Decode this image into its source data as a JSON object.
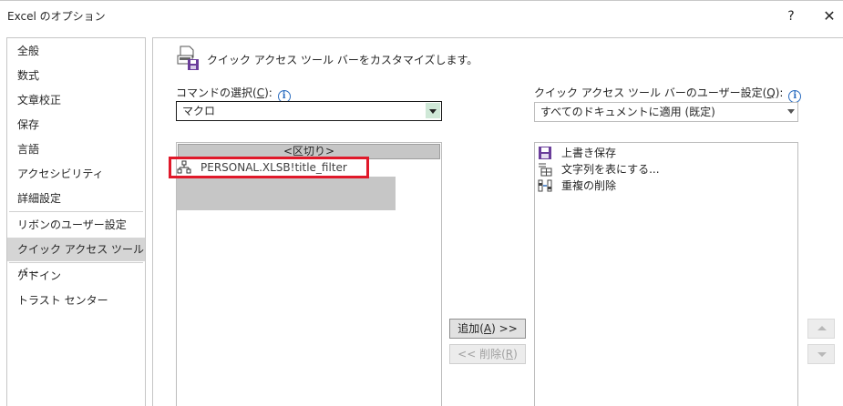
{
  "window": {
    "title": "Excel のオプション",
    "help": "?",
    "close": "✕"
  },
  "sidebar": {
    "items": [
      {
        "label": "全般"
      },
      {
        "label": "数式"
      },
      {
        "label": "文章校正"
      },
      {
        "label": "保存"
      },
      {
        "label": "言語"
      },
      {
        "label": "アクセシビリティ"
      },
      {
        "label": "詳細設定"
      },
      {
        "label": "リボンのユーザー設定"
      },
      {
        "label": "クイック アクセス ツール バー"
      },
      {
        "label": "アドイン"
      },
      {
        "label": "トラスト センター"
      }
    ],
    "active_index": 8
  },
  "main": {
    "header": "クイック アクセス ツール バーをカスタマイズします。",
    "commands_label_prefix": "コマンドの選択(",
    "commands_label_key": "C",
    "commands_label_suffix": "):",
    "commands_value": "マクロ",
    "customize_label_prefix": "クイック アクセス ツール バーのユーザー設定(",
    "customize_label_key": "Q",
    "customize_label_suffix": "):",
    "customize_value": "すべてのドキュメントに適用 (既定)",
    "left_list": {
      "separator": "<区切り>",
      "macro": "PERSONAL.XLSB!title_filter"
    },
    "right_list": [
      {
        "label": "上書き保存",
        "icon": "save-icon"
      },
      {
        "label": "文字列を表にする...",
        "icon": "text-to-table-icon"
      },
      {
        "label": "重複の削除",
        "icon": "remove-duplicates-icon"
      }
    ],
    "add_button_prefix": "追加(",
    "add_button_key": "A",
    "add_button_suffix": ") >>",
    "remove_button_prefix": "<< 削除(",
    "remove_button_key": "R",
    "remove_button_suffix": ")"
  },
  "colors": {
    "highlight_red": "#e0192a",
    "active_sidebar": "#d5d5d5",
    "info_blue": "#2b6dc0",
    "save_purple": "#6a3d9a"
  }
}
